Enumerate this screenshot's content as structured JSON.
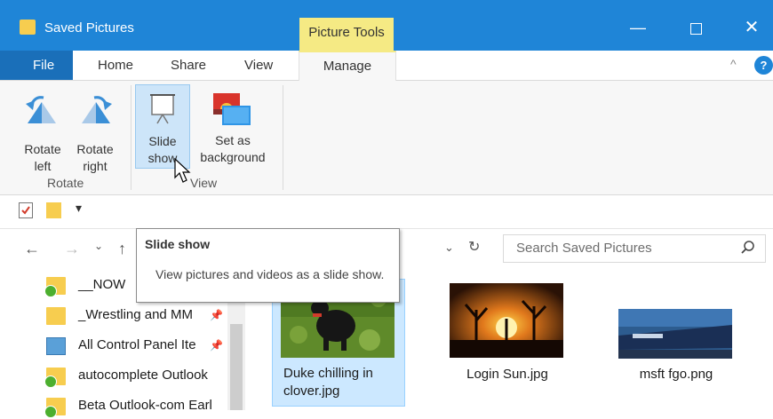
{
  "window": {
    "title": "Saved Pictures",
    "context_tab": "Picture Tools",
    "controls": {
      "minimize": "—",
      "close": "✕"
    }
  },
  "tabs": {
    "file": "File",
    "home": "Home",
    "share": "Share",
    "view": "View",
    "manage": "Manage",
    "collapse": "^",
    "help": "?"
  },
  "ribbon": {
    "rotate_left": [
      "Rotate",
      "left"
    ],
    "rotate_right": [
      "Rotate",
      "right"
    ],
    "slide_show": [
      "Slide",
      "show"
    ],
    "set_as_background": [
      "Set as",
      "background"
    ],
    "group_rotate": "Rotate",
    "group_view": "View"
  },
  "address": {
    "search_placeholder": "Search Saved Pictures"
  },
  "tooltip": {
    "title": "Slide show",
    "body": "View pictures and videos as a slide show."
  },
  "nav_pane": {
    "items": [
      {
        "label": "__NOW",
        "icon": "folder-sync-icon"
      },
      {
        "label": "_Wrestling and MM",
        "icon": "folder-icon"
      },
      {
        "label": "All Control Panel Ite",
        "icon": "control-panel-icon"
      },
      {
        "label": "autocomplete Outlook",
        "icon": "folder-sync-icon"
      },
      {
        "label": "Beta Outlook-com Earl",
        "icon": "folder-sync-icon"
      }
    ]
  },
  "files": [
    {
      "name_lines": [
        "Duke chilling in",
        "clover.jpg"
      ],
      "selected": true
    },
    {
      "name_lines": [
        "Login Sun.jpg"
      ],
      "selected": false
    },
    {
      "name_lines": [
        "msft fgo.png"
      ],
      "selected": false
    }
  ],
  "colors": {
    "titlebar": "#1f85d7",
    "file_tab": "#1a6fb9",
    "picture_tools": "#f5ea84",
    "selection": "#cce8ff",
    "folder": "#f7cd4f"
  }
}
